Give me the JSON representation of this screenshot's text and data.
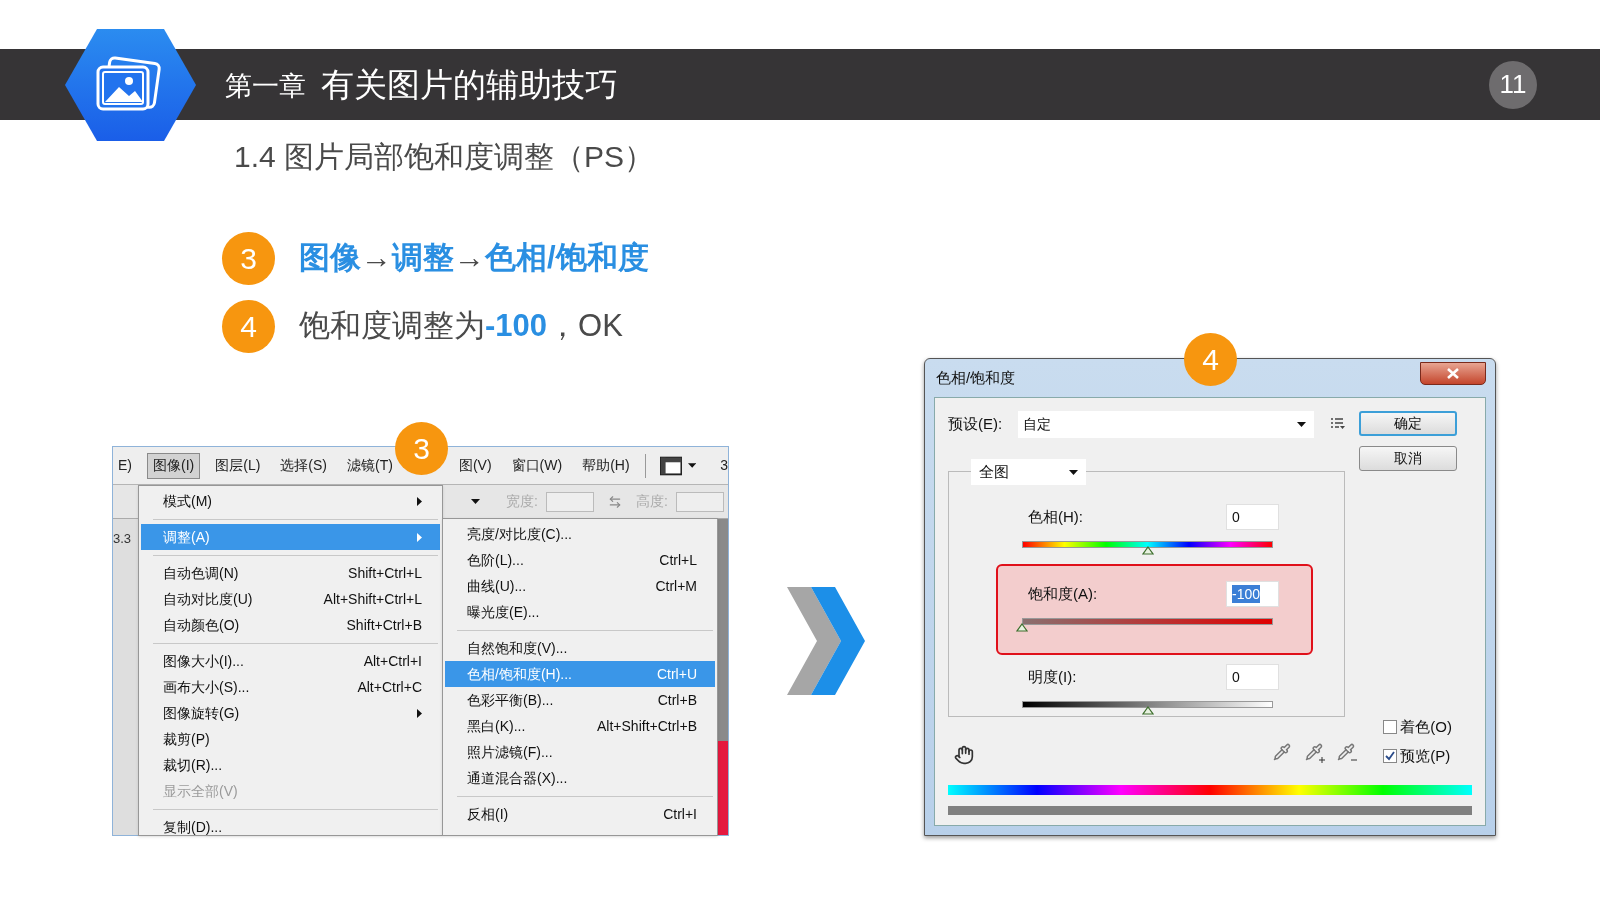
{
  "header": {
    "chapter": "第一章",
    "title": "有关图片的辅助技巧",
    "page_number": "11"
  },
  "subtitle": "1.4 图片局部饱和度调整（PS）",
  "steps": [
    {
      "number": "3",
      "text": "**图像**→**调整**→**色相/饱和度**"
    },
    {
      "number": "4",
      "text": "饱和度调整为**-100**，OK"
    }
  ],
  "menu_screenshot": {
    "badge": "3",
    "menubar": [
      {
        "label": "E)",
        "selected": false
      },
      {
        "label": "图像(I)",
        "selected": true
      },
      {
        "label": "图层(L)",
        "selected": false
      },
      {
        "label": "选择(S)",
        "selected": false
      },
      {
        "label": "滤镜(T)",
        "selected": false
      },
      {
        "label": "图(V)",
        "selected": false
      },
      {
        "label": "窗口(W)",
        "selected": false
      },
      {
        "label": "帮助(H)",
        "selected": false
      }
    ],
    "menubar_edge": "3",
    "options_bar": {
      "width_label": "宽度:",
      "height_label": "高度:"
    },
    "ruler_value": "3.3",
    "menu": [
      {
        "kind": "item",
        "label": "模式(M)",
        "submenu": true,
        "selected": false,
        "disabled": false
      },
      {
        "kind": "separator"
      },
      {
        "kind": "item",
        "label": "调整(A)",
        "submenu": true,
        "selected": true,
        "disabled": false
      },
      {
        "kind": "separator"
      },
      {
        "kind": "item",
        "label": "自动色调(N)",
        "shortcut": "Shift+Ctrl+L",
        "submenu": false,
        "selected": false,
        "disabled": false
      },
      {
        "kind": "item",
        "label": "自动对比度(U)",
        "shortcut": "Alt+Shift+Ctrl+L",
        "submenu": false,
        "selected": false,
        "disabled": false
      },
      {
        "kind": "item",
        "label": "自动颜色(O)",
        "shortcut": "Shift+Ctrl+B",
        "submenu": false,
        "selected": false,
        "disabled": false
      },
      {
        "kind": "separator"
      },
      {
        "kind": "item",
        "label": "图像大小(I)...",
        "shortcut": "Alt+Ctrl+I",
        "submenu": false,
        "selected": false,
        "disabled": false
      },
      {
        "kind": "item",
        "label": "画布大小(S)...",
        "shortcut": "Alt+Ctrl+C",
        "submenu": false,
        "selected": false,
        "disabled": false
      },
      {
        "kind": "item",
        "label": "图像旋转(G)",
        "submenu": true,
        "selected": false,
        "disabled": false
      },
      {
        "kind": "item",
        "label": "裁剪(P)",
        "submenu": false,
        "selected": false,
        "disabled": false
      },
      {
        "kind": "item",
        "label": "裁切(R)...",
        "submenu": false,
        "selected": false,
        "disabled": false
      },
      {
        "kind": "item",
        "label": "显示全部(V)",
        "submenu": false,
        "selected": false,
        "disabled": true
      },
      {
        "kind": "separator"
      },
      {
        "kind": "item",
        "label": "复制(D)...",
        "submenu": false,
        "selected": false,
        "disabled": false
      }
    ],
    "submenu": [
      {
        "kind": "item",
        "label": "亮度/对比度(C)...",
        "submenu": false,
        "selected": false,
        "disabled": false
      },
      {
        "kind": "item",
        "label": "色阶(L)...",
        "shortcut": "Ctrl+L",
        "submenu": false,
        "selected": false,
        "disabled": false
      },
      {
        "kind": "item",
        "label": "曲线(U)...",
        "shortcut": "Ctrl+M",
        "submenu": false,
        "selected": false,
        "disabled": false
      },
      {
        "kind": "item",
        "label": "曝光度(E)...",
        "submenu": false,
        "selected": false,
        "disabled": false
      },
      {
        "kind": "separator"
      },
      {
        "kind": "item",
        "label": "自然饱和度(V)...",
        "submenu": false,
        "selected": false,
        "disabled": false
      },
      {
        "kind": "item",
        "label": "色相/饱和度(H)...",
        "shortcut": "Ctrl+U",
        "submenu": false,
        "selected": true,
        "disabled": false
      },
      {
        "kind": "item",
        "label": "色彩平衡(B)...",
        "shortcut": "Ctrl+B",
        "submenu": false,
        "selected": false,
        "disabled": false
      },
      {
        "kind": "item",
        "label": "黑白(K)...",
        "shortcut": "Alt+Shift+Ctrl+B",
        "submenu": false,
        "selected": false,
        "disabled": false
      },
      {
        "kind": "item",
        "label": "照片滤镜(F)...",
        "submenu": false,
        "selected": false,
        "disabled": false
      },
      {
        "kind": "item",
        "label": "通道混合器(X)...",
        "submenu": false,
        "selected": false,
        "disabled": false
      },
      {
        "kind": "separator"
      },
      {
        "kind": "item",
        "label": "反相(I)",
        "shortcut": "Ctrl+I",
        "submenu": false,
        "selected": false,
        "disabled": false
      }
    ]
  },
  "dialog": {
    "badge": "4",
    "title": "色相/饱和度",
    "preset_label": "预设(E):",
    "preset_value": "自定",
    "buttons": [
      {
        "label": "确定",
        "default": true
      },
      {
        "label": "取消",
        "default": false
      }
    ],
    "channel": "全图",
    "sliders": [
      {
        "kind": "hue",
        "label": "色相(H):",
        "value": "0",
        "level": 0.5,
        "highlighted": false,
        "value_selected": false
      },
      {
        "kind": "saturation",
        "label": "饱和度(A):",
        "value": "-100",
        "level": 0,
        "highlighted": true,
        "value_selected": true
      },
      {
        "kind": "lightness",
        "label": "明度(I):",
        "value": "0",
        "level": 0.5,
        "highlighted": false,
        "value_selected": false
      }
    ],
    "checkboxes": [
      {
        "label": "着色(O)",
        "checked": false
      },
      {
        "label": "预览(P)",
        "checked": true
      }
    ]
  }
}
